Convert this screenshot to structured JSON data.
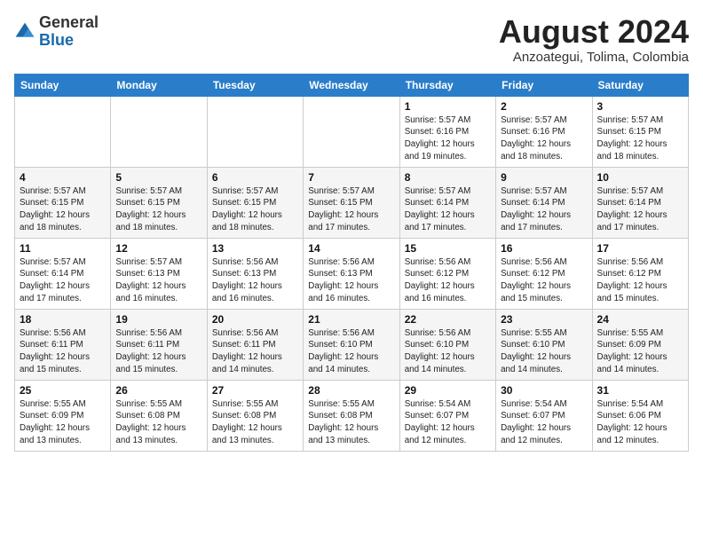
{
  "header": {
    "logo_general": "General",
    "logo_blue": "Blue",
    "month_year": "August 2024",
    "location": "Anzoategui, Tolima, Colombia"
  },
  "weekdays": [
    "Sunday",
    "Monday",
    "Tuesday",
    "Wednesday",
    "Thursday",
    "Friday",
    "Saturday"
  ],
  "weeks": [
    [
      {
        "day": "",
        "info": ""
      },
      {
        "day": "",
        "info": ""
      },
      {
        "day": "",
        "info": ""
      },
      {
        "day": "",
        "info": ""
      },
      {
        "day": "1",
        "info": "Sunrise: 5:57 AM\nSunset: 6:16 PM\nDaylight: 12 hours\nand 19 minutes."
      },
      {
        "day": "2",
        "info": "Sunrise: 5:57 AM\nSunset: 6:16 PM\nDaylight: 12 hours\nand 18 minutes."
      },
      {
        "day": "3",
        "info": "Sunrise: 5:57 AM\nSunset: 6:15 PM\nDaylight: 12 hours\nand 18 minutes."
      }
    ],
    [
      {
        "day": "4",
        "info": "Sunrise: 5:57 AM\nSunset: 6:15 PM\nDaylight: 12 hours\nand 18 minutes."
      },
      {
        "day": "5",
        "info": "Sunrise: 5:57 AM\nSunset: 6:15 PM\nDaylight: 12 hours\nand 18 minutes."
      },
      {
        "day": "6",
        "info": "Sunrise: 5:57 AM\nSunset: 6:15 PM\nDaylight: 12 hours\nand 18 minutes."
      },
      {
        "day": "7",
        "info": "Sunrise: 5:57 AM\nSunset: 6:15 PM\nDaylight: 12 hours\nand 17 minutes."
      },
      {
        "day": "8",
        "info": "Sunrise: 5:57 AM\nSunset: 6:14 PM\nDaylight: 12 hours\nand 17 minutes."
      },
      {
        "day": "9",
        "info": "Sunrise: 5:57 AM\nSunset: 6:14 PM\nDaylight: 12 hours\nand 17 minutes."
      },
      {
        "day": "10",
        "info": "Sunrise: 5:57 AM\nSunset: 6:14 PM\nDaylight: 12 hours\nand 17 minutes."
      }
    ],
    [
      {
        "day": "11",
        "info": "Sunrise: 5:57 AM\nSunset: 6:14 PM\nDaylight: 12 hours\nand 17 minutes."
      },
      {
        "day": "12",
        "info": "Sunrise: 5:57 AM\nSunset: 6:13 PM\nDaylight: 12 hours\nand 16 minutes."
      },
      {
        "day": "13",
        "info": "Sunrise: 5:56 AM\nSunset: 6:13 PM\nDaylight: 12 hours\nand 16 minutes."
      },
      {
        "day": "14",
        "info": "Sunrise: 5:56 AM\nSunset: 6:13 PM\nDaylight: 12 hours\nand 16 minutes."
      },
      {
        "day": "15",
        "info": "Sunrise: 5:56 AM\nSunset: 6:12 PM\nDaylight: 12 hours\nand 16 minutes."
      },
      {
        "day": "16",
        "info": "Sunrise: 5:56 AM\nSunset: 6:12 PM\nDaylight: 12 hours\nand 15 minutes."
      },
      {
        "day": "17",
        "info": "Sunrise: 5:56 AM\nSunset: 6:12 PM\nDaylight: 12 hours\nand 15 minutes."
      }
    ],
    [
      {
        "day": "18",
        "info": "Sunrise: 5:56 AM\nSunset: 6:11 PM\nDaylight: 12 hours\nand 15 minutes."
      },
      {
        "day": "19",
        "info": "Sunrise: 5:56 AM\nSunset: 6:11 PM\nDaylight: 12 hours\nand 15 minutes."
      },
      {
        "day": "20",
        "info": "Sunrise: 5:56 AM\nSunset: 6:11 PM\nDaylight: 12 hours\nand 14 minutes."
      },
      {
        "day": "21",
        "info": "Sunrise: 5:56 AM\nSunset: 6:10 PM\nDaylight: 12 hours\nand 14 minutes."
      },
      {
        "day": "22",
        "info": "Sunrise: 5:56 AM\nSunset: 6:10 PM\nDaylight: 12 hours\nand 14 minutes."
      },
      {
        "day": "23",
        "info": "Sunrise: 5:55 AM\nSunset: 6:10 PM\nDaylight: 12 hours\nand 14 minutes."
      },
      {
        "day": "24",
        "info": "Sunrise: 5:55 AM\nSunset: 6:09 PM\nDaylight: 12 hours\nand 14 minutes."
      }
    ],
    [
      {
        "day": "25",
        "info": "Sunrise: 5:55 AM\nSunset: 6:09 PM\nDaylight: 12 hours\nand 13 minutes."
      },
      {
        "day": "26",
        "info": "Sunrise: 5:55 AM\nSunset: 6:08 PM\nDaylight: 12 hours\nand 13 minutes."
      },
      {
        "day": "27",
        "info": "Sunrise: 5:55 AM\nSunset: 6:08 PM\nDaylight: 12 hours\nand 13 minutes."
      },
      {
        "day": "28",
        "info": "Sunrise: 5:55 AM\nSunset: 6:08 PM\nDaylight: 12 hours\nand 13 minutes."
      },
      {
        "day": "29",
        "info": "Sunrise: 5:54 AM\nSunset: 6:07 PM\nDaylight: 12 hours\nand 12 minutes."
      },
      {
        "day": "30",
        "info": "Sunrise: 5:54 AM\nSunset: 6:07 PM\nDaylight: 12 hours\nand 12 minutes."
      },
      {
        "day": "31",
        "info": "Sunrise: 5:54 AM\nSunset: 6:06 PM\nDaylight: 12 hours\nand 12 minutes."
      }
    ]
  ]
}
